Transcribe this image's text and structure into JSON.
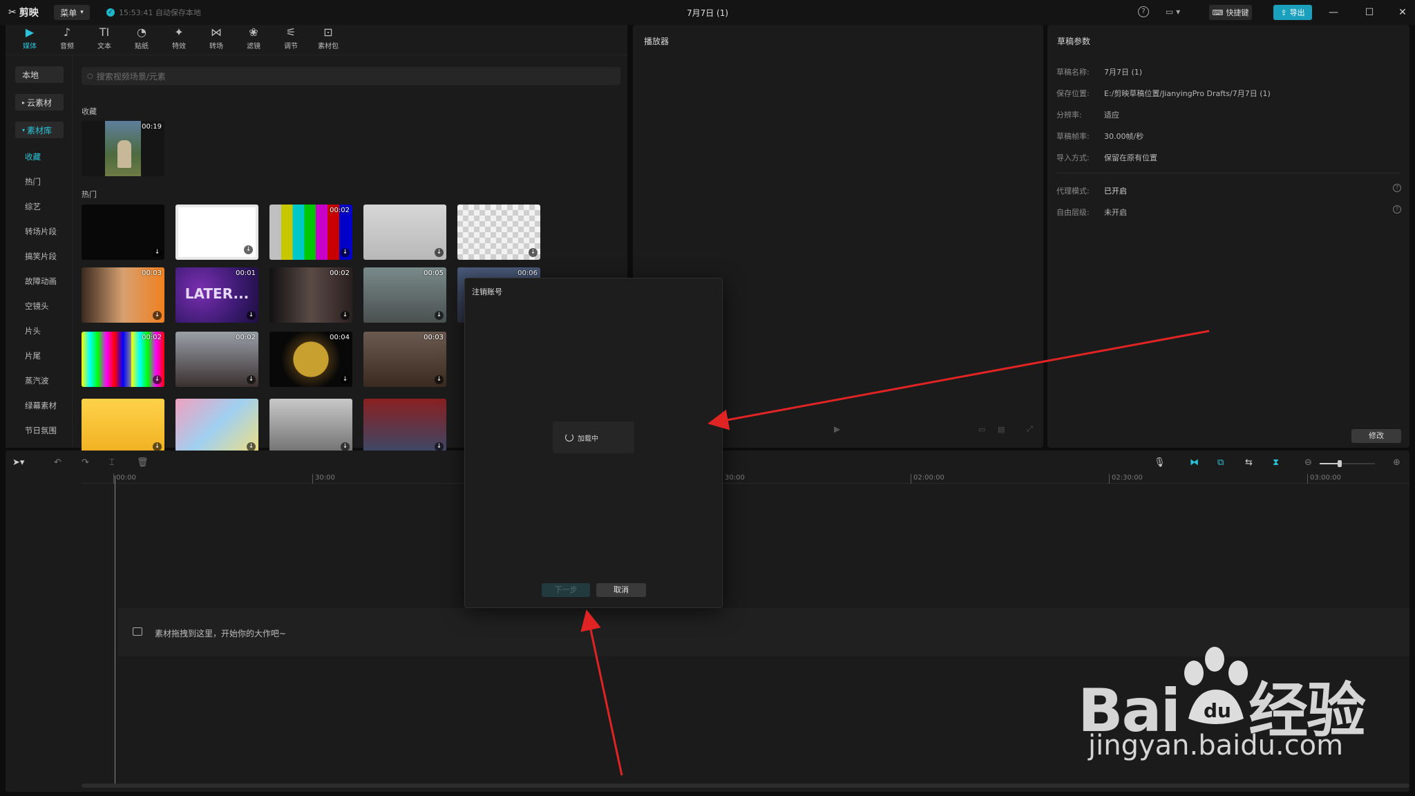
{
  "app": {
    "logo_text": "剪映",
    "menu_label": "菜单",
    "autosave_text": "15:53:41 自动保存本地",
    "window_title": "7月7日 (1)",
    "shortcut_label": "快捷键",
    "export_label": "导出"
  },
  "toolbar": {
    "items": [
      {
        "label": "媒体",
        "icon": "▶"
      },
      {
        "label": "音频",
        "icon": "♪"
      },
      {
        "label": "文本",
        "icon": "TI"
      },
      {
        "label": "贴纸",
        "icon": "◔"
      },
      {
        "label": "特效",
        "icon": "✦"
      },
      {
        "label": "转场",
        "icon": "⋈"
      },
      {
        "label": "滤镜",
        "icon": "❀"
      },
      {
        "label": "调节",
        "icon": "⚟"
      },
      {
        "label": "素材包",
        "icon": "⊡"
      }
    ]
  },
  "sidebar": {
    "local": "本地",
    "cloud": "云素材",
    "library": "素材库",
    "items": [
      "收藏",
      "热门",
      "综艺",
      "转场片段",
      "搞笑片段",
      "故障动画",
      "空镜头",
      "片头",
      "片尾",
      "蒸汽波",
      "绿幕素材",
      "节日氛围"
    ]
  },
  "search": {
    "placeholder": "搜索视频场景/元素"
  },
  "sections": {
    "favorites": "收藏",
    "hot": "热门"
  },
  "thumbs": {
    "fav": [
      {
        "dur": "00:19"
      }
    ],
    "rows": [
      [
        {
          "dur": ""
        },
        {
          "dur": ""
        },
        {
          "dur": "00:02"
        },
        {
          "dur": ""
        },
        {
          "dur": ""
        }
      ],
      [
        {
          "dur": "00:03"
        },
        {
          "dur": "00:01"
        },
        {
          "dur": "00:02"
        },
        {
          "dur": "00:05"
        },
        {
          "dur": "00:06"
        }
      ],
      [
        {
          "dur": "00:02"
        },
        {
          "dur": "00:02"
        },
        {
          "dur": "00:04"
        },
        {
          "dur": "00:03"
        }
      ],
      [
        {
          "dur": ""
        },
        {
          "dur": ""
        },
        {
          "dur": ""
        },
        {
          "dur": ""
        }
      ]
    ],
    "later_text": "LATER..."
  },
  "player": {
    "title": "播放器"
  },
  "draft": {
    "title": "草稿参数",
    "params": [
      {
        "label": "草稿名称:",
        "value": "7月7日 (1)"
      },
      {
        "label": "保存位置:",
        "value": "E:/剪映草稿位置/JianyingPro Drafts/7月7日 (1)"
      },
      {
        "label": "分辨率:",
        "value": "适应"
      },
      {
        "label": "草稿帧率:",
        "value": "30.00帧/秒"
      },
      {
        "label": "导入方式:",
        "value": "保留在原有位置"
      }
    ],
    "proxy_label": "代理模式:",
    "proxy_value": "已开启",
    "free_layer_label": "自由层级:",
    "free_layer_value": "未开启",
    "modify_label": "修改"
  },
  "timeline": {
    "ticks": [
      "00:00",
      "30:00",
      "30:00",
      "02:00:00",
      "02:30:00",
      "03:00:00"
    ],
    "hint": "素材拖拽到这里，开始你的大作吧~"
  },
  "dialog": {
    "title": "注销账号",
    "loading": "加载中",
    "next_label": "下一步",
    "cancel_label": "取消"
  },
  "watermark": {
    "brand": "Bai du 经验",
    "url": "jingyan.baidu.com"
  },
  "colors": {
    "accent": "#2bc3d8",
    "export": "#1a9fbc",
    "arrow": "#e02424"
  }
}
